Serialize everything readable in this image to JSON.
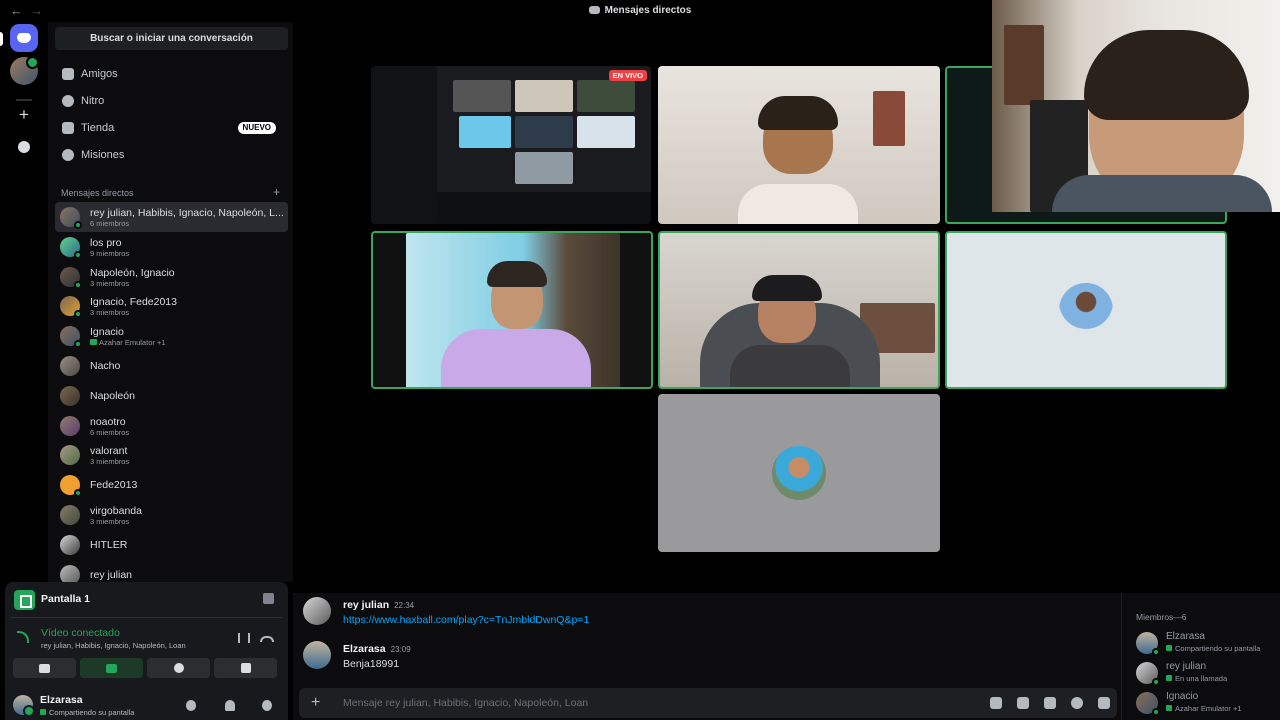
{
  "topbar": {
    "title": "Mensajes directos"
  },
  "sidebar": {
    "search_label": "Buscar o iniciar una conversación",
    "nav": [
      {
        "label": "Amigos",
        "icon": "friends-icon"
      },
      {
        "label": "Nitro",
        "icon": "nitro-icon"
      },
      {
        "label": "Tienda",
        "icon": "shop-icon",
        "badge": "NUEVO"
      },
      {
        "label": "Misiones",
        "icon": "quests-icon"
      }
    ],
    "dm_header": "Mensajes directos",
    "dms": [
      {
        "name": "rey julian, Habibis, Ignacio, Napoleón, L...",
        "sub": "6 miembros",
        "active": true
      },
      {
        "name": "los pro",
        "sub": "9 miembros"
      },
      {
        "name": "Napoleón, Ignacio",
        "sub": "3 miembros"
      },
      {
        "name": "Ignacio, Fede2013",
        "sub": "3 miembros"
      },
      {
        "name": "Ignacio",
        "sub": "Azahar Emulator +1",
        "game": true
      },
      {
        "name": "Nacho",
        "sub": ""
      },
      {
        "name": "Napoleón",
        "sub": ""
      },
      {
        "name": "noaotro",
        "sub": "6 miembros"
      },
      {
        "name": "valorant",
        "sub": "3 miembros"
      },
      {
        "name": "Fede2013",
        "sub": ""
      },
      {
        "name": "virgobanda",
        "sub": "3 miembros"
      },
      {
        "name": "HITLER",
        "sub": ""
      },
      {
        "name": "rey julian",
        "sub": ""
      }
    ]
  },
  "voice_panel": {
    "title": "Pantalla 1",
    "status": "Vídeo conectado",
    "channel": "rey julian, Habibis, Ignacio, Napoleón, Loan"
  },
  "user": {
    "name": "Elzarasa",
    "status": "Compartiendo su pantalla"
  },
  "call": {
    "live_badge": "EN VIVO"
  },
  "chat": {
    "messages": [
      {
        "author": "rey julian",
        "time": "22:34",
        "text": "https://www.haxball.com/play?c=TnJmbldDwnQ&p=1",
        "link": true
      },
      {
        "author": "Elzarasa",
        "time": "23:09",
        "text": "Benja18991",
        "link": false
      }
    ],
    "placeholder": "Mensaje rey julian, Habibis, Ignacio, Napoleón, Loan"
  },
  "members": {
    "header": "Miembros—6",
    "list": [
      {
        "name": "Elzarasa",
        "status": "Compartiendo su pantalla"
      },
      {
        "name": "rey julian",
        "status": "En una llamada"
      },
      {
        "name": "Ignacio",
        "status": "Azahar Emulator +1"
      }
    ]
  },
  "colors": {
    "brand": "#5865f2",
    "online": "#23a55a",
    "live": "#ed4245",
    "link": "#00a8fc"
  }
}
